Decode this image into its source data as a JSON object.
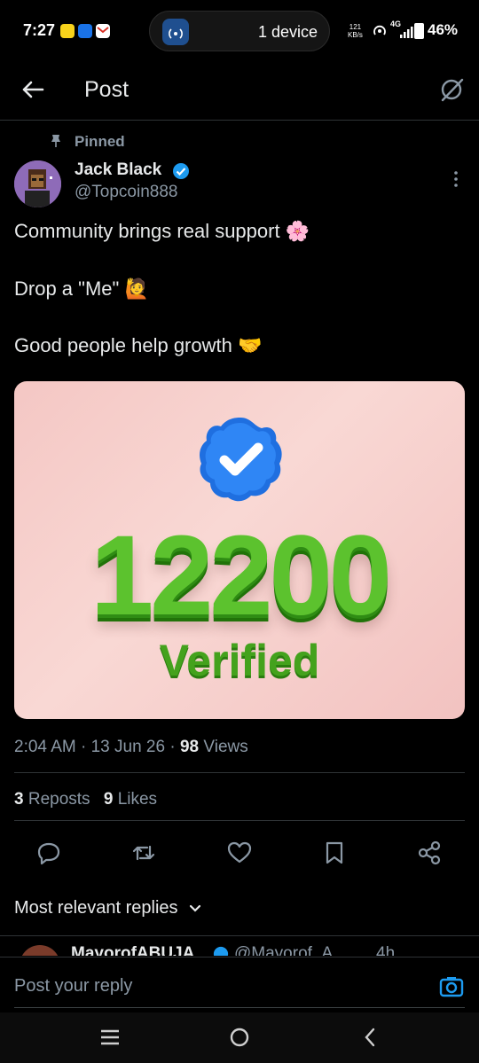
{
  "status_bar": {
    "time": "7:27",
    "center_pill": "1 device",
    "net_speed": "121",
    "net_unit": "KB/s",
    "signal": "4G",
    "battery": "46%"
  },
  "header": {
    "title": "Post"
  },
  "post": {
    "pinned_label": "Pinned",
    "author_name": "Jack Black",
    "author_handle": "@Topcoin888",
    "lines": [
      "Community brings real support 🌸",
      "Drop a \"Me\" 🙋",
      "Good people help growth 🤝"
    ],
    "image": {
      "number": "12200",
      "caption": "Verified"
    },
    "time": "2:04 AM",
    "date": "13 Jun 26",
    "views_count": "98",
    "views_label": "Views",
    "reposts_count": "3",
    "reposts_label": "Reposts",
    "likes_count": "9",
    "likes_label": "Likes"
  },
  "replies": {
    "sort_label": "Most relevant replies",
    "first_reply_name": "MayorofABUJA",
    "first_reply_handle": "@Mayorof_A...",
    "first_reply_time": "4h"
  },
  "composer": {
    "placeholder": "Post your reply"
  },
  "colors": {
    "accent": "#1d9bf0",
    "muted": "#8b98a5",
    "background": "#000000",
    "verified_green": "#5cc22e"
  }
}
